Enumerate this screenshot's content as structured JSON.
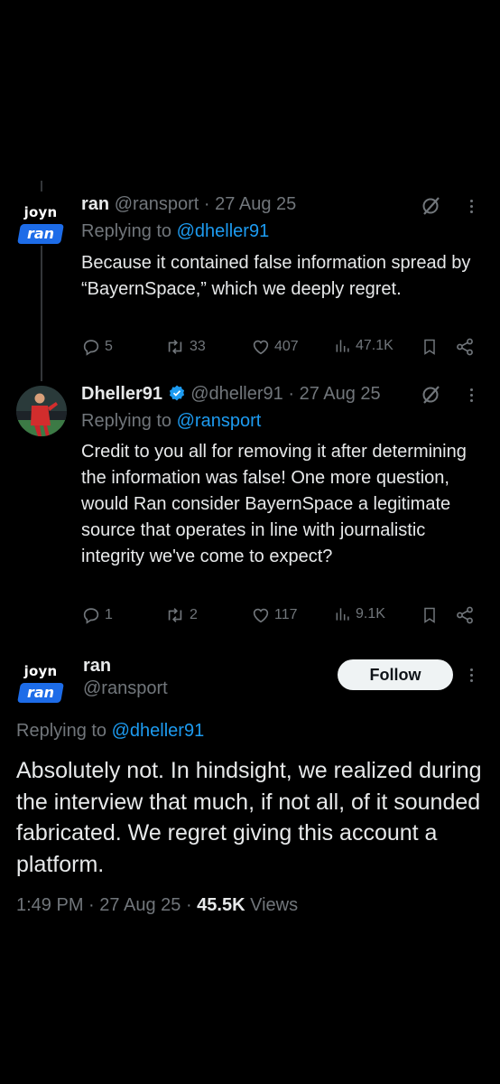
{
  "tweets": [
    {
      "name": "ran",
      "handle": "@ransport",
      "sep": "·",
      "date": "27 Aug 25",
      "replying_label": "Replying to",
      "replying_to": "@dheller91",
      "text": "Because it contained false information spread by “BayernSpace,” which we deeply regret.",
      "replies": "5",
      "reposts": "33",
      "likes": "407",
      "views": "47.1K",
      "logo_top": "joyn",
      "logo_bottom": "ran"
    },
    {
      "name": "Dheller91",
      "handle": "@dheller91",
      "sep": "·",
      "date": "27 Aug 25",
      "replying_label": "Replying to",
      "replying_to": "@ransport",
      "text": "Credit to you all for removing it after determining the information was false! One more question, would Ran consider BayernSpace a legitimate source that operates in line with journalistic integrity we've come to expect?",
      "replies": "1",
      "reposts": "2",
      "likes": "117",
      "views": "9.1K"
    }
  ],
  "main": {
    "name": "ran",
    "handle": "@ransport",
    "follow_label": "Follow",
    "replying_label": "Replying to",
    "replying_to": "@dheller91",
    "text": "Absolutely not. In hindsight, we realized during the interview that much, if not all, of it sounded fabricated. We regret giving this account a platform.",
    "time": "1:49 PM",
    "date": "27 Aug 25",
    "sep": "·",
    "views_count": "45.5K",
    "views_label": "Views",
    "logo_top": "joyn",
    "logo_bottom": "ran"
  },
  "colors": {
    "background": "#000000",
    "text": "#e7e9ea",
    "muted": "#71767b",
    "link": "#1d9bf0",
    "verified": "#1d9bf0",
    "ran_logo": "#1d6ce8"
  },
  "icons": [
    "reply-icon",
    "repost-icon",
    "like-icon",
    "views-icon",
    "bookmark-icon",
    "share-icon",
    "grok-icon",
    "more-icon",
    "verified-badge-icon"
  ]
}
